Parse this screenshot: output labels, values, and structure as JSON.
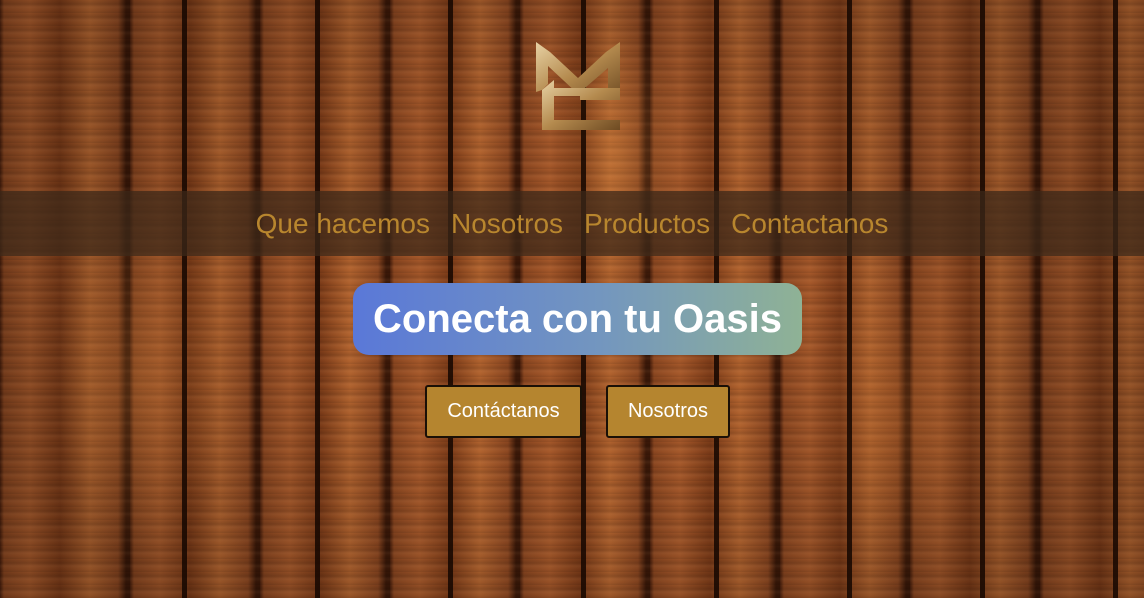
{
  "brand": {
    "logo": "fm-monogram-logo",
    "accent_color": "#b8862e"
  },
  "nav": {
    "items": [
      {
        "label": "Que hacemos"
      },
      {
        "label": "Nosotros"
      },
      {
        "label": "Productos"
      },
      {
        "label": "Contactanos"
      }
    ]
  },
  "hero": {
    "title": "Conecta con tu Oasis"
  },
  "actions": {
    "contact_label": "Contáctanos",
    "about_label": "Nosotros"
  },
  "colors": {
    "button_bg": "#b5852f",
    "hero_gradient": [
      "#5a78d8",
      "#7396bf",
      "#8fb295"
    ]
  }
}
